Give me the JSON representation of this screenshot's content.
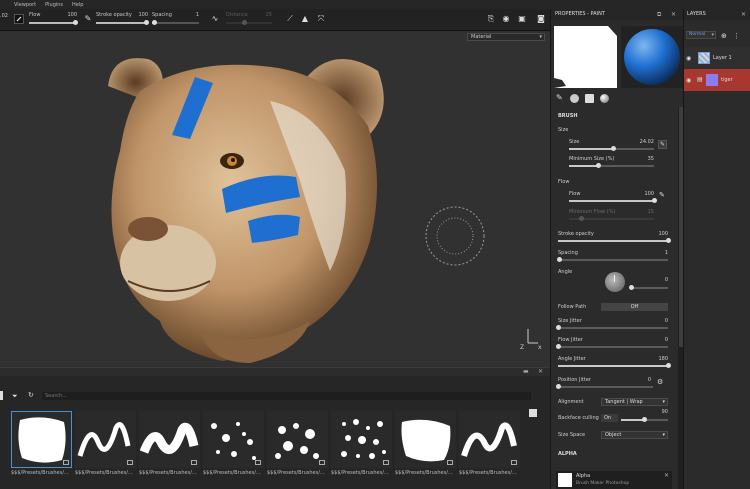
{
  "menu": [
    "Viewport",
    "Plugins",
    "Help"
  ],
  "toolbar": {
    "brush_value": ".02",
    "flow_label": "Flow",
    "flow_value": "100",
    "stroke_opacity_label": "Stroke opacity",
    "stroke_opacity_value": "100",
    "spacing_label": "Spacing",
    "spacing_value": "1",
    "distance_label": "Distance",
    "distance_value": "25"
  },
  "viewport": {
    "channel_dropdown": "Material"
  },
  "properties": {
    "title": "PROPERTIES - PAINT",
    "section_brush": "BRUSH",
    "size_group": "Size",
    "size_label": "Size",
    "size_value": "24.02",
    "size_fill": 0.52,
    "min_size_label": "Minimum Size (%)",
    "min_size_value": "35",
    "min_size_fill": 0.35,
    "flow_group": "Flow",
    "flow_label": "Flow",
    "flow_value": "100",
    "flow_fill": 1.0,
    "min_flow_label": "Minimum Flow (%)",
    "min_flow_value": "15",
    "min_flow_fill": 0.15,
    "stroke_opacity_label": "Stroke opacity",
    "stroke_opacity_value": "100",
    "stroke_opacity_fill": 1.0,
    "spacing_label": "Spacing",
    "spacing_value": "1",
    "spacing_fill": 0.01,
    "angle_label": "Angle",
    "angle_value": "0",
    "angle_fill": 0.0,
    "follow_path_label": "Follow Path",
    "follow_path_value": "Off",
    "size_jitter_label": "Size Jitter",
    "size_jitter_value": "0",
    "size_jitter_fill": 0.0,
    "flow_jitter_label": "Flow Jitter",
    "flow_jitter_value": "0",
    "flow_jitter_fill": 0.0,
    "angle_jitter_label": "Angle Jitter",
    "angle_jitter_value": "180",
    "angle_jitter_fill": 1.0,
    "position_jitter_label": "Position Jitter",
    "position_jitter_value": "0",
    "position_jitter_fill": 0.0,
    "alignment_label": "Alignment",
    "alignment_value": "Tangent | Wrap",
    "backface_label": "Backface culling",
    "backface_toggle": "On",
    "backface_value": "90",
    "backface_fill": 0.5,
    "size_space_label": "Size Space",
    "size_space_value": "Object",
    "section_alpha": "ALPHA",
    "alpha_name": "Alpha",
    "alpha_sub": "Brush Maker Photoshop"
  },
  "layers": {
    "title": "LAYERS",
    "blend_mode": "Normal",
    "items": [
      {
        "name": "Layer 1"
      },
      {
        "name": "tiger"
      }
    ]
  },
  "browser": {
    "search_placeholder": "Search...",
    "thumb_caption": "$$$/Presets/Brushes/..."
  },
  "colors": {
    "accent_blue": "#1f6fd1",
    "layer_red": "#a8372f",
    "selection": "#4a90d9"
  }
}
